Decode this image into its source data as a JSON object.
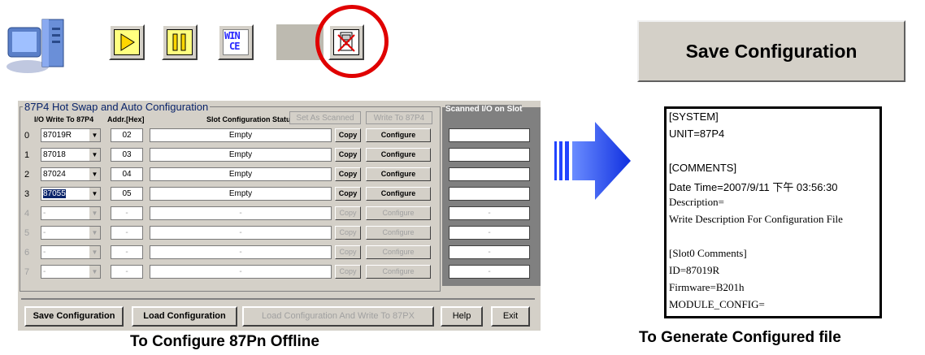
{
  "toolbar": {
    "icons": [
      "computer-icon",
      "play-icon",
      "pause-icon",
      "wince-icon",
      "blank-icon",
      "offline-module-icon"
    ],
    "wince_label_top": "WIN",
    "wince_label_bottom": "CE"
  },
  "dialog": {
    "title": "87P4 Hot Swap and Auto Configuration",
    "col_io": "I/O Write To 87P4",
    "col_addr": "Addr.[Hex]",
    "col_status": "Slot Configuration Status",
    "set_as_scanned": "Set As Scanned",
    "write_to_87p4": "Write To 87P4",
    "scanned_title": "Scanned I/O on Slot",
    "rows": [
      {
        "index": "0",
        "module": "87019R",
        "addr": "02",
        "status": "Empty",
        "copy": "Copy",
        "configure": "Configure",
        "scanned": ""
      },
      {
        "index": "1",
        "module": "87018",
        "addr": "03",
        "status": "Empty",
        "copy": "Copy",
        "configure": "Configure",
        "scanned": ""
      },
      {
        "index": "2",
        "module": "87024",
        "addr": "04",
        "status": "Empty",
        "copy": "Copy",
        "configure": "Configure",
        "scanned": ""
      },
      {
        "index": "3",
        "module": "87055",
        "addr": "05",
        "status": "Empty",
        "copy": "Copy",
        "configure": "Configure",
        "scanned": ""
      },
      {
        "index": "4",
        "module": "-",
        "addr": "-",
        "status": "-",
        "copy": "Copy",
        "configure": "Configure",
        "scanned": "-"
      },
      {
        "index": "5",
        "module": "-",
        "addr": "-",
        "status": "-",
        "copy": "Copy",
        "configure": "Configure",
        "scanned": "-"
      },
      {
        "index": "6",
        "module": "-",
        "addr": "-",
        "status": "-",
        "copy": "Copy",
        "configure": "Configure",
        "scanned": "-"
      },
      {
        "index": "7",
        "module": "-",
        "addr": "-",
        "status": "-",
        "copy": "Copy",
        "configure": "Configure",
        "scanned": "-"
      }
    ],
    "buttons": {
      "save": "Save Configuration",
      "load": "Load Configuration",
      "load_write": "Load Configuration And Write To 87PX",
      "help": "Help",
      "exit": "Exit"
    }
  },
  "caption_left": "To Configure 87Pn Offline",
  "save_config_button": "Save Configuration",
  "file_lines": [
    "[SYSTEM]",
    "UNIT=87P4",
    "",
    "[COMMENTS]",
    "Date Time=2007/9/11 下午 03:56:30",
    "Description=",
    "Write Description For Configuration File",
    "",
    "[Slot0 Comments]",
    "ID=87019R",
    "Firmware=B201h",
    "MODULE_CONFIG="
  ],
  "caption_right": "To Generate Configured file"
}
